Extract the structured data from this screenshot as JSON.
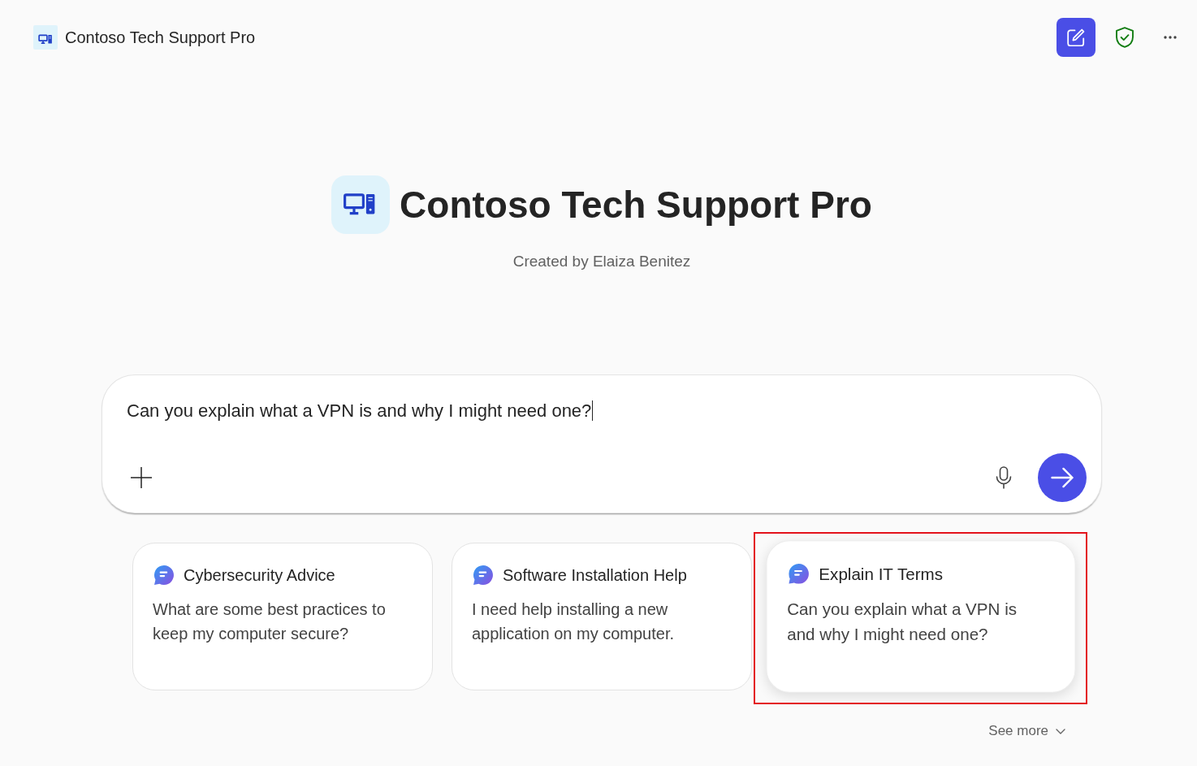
{
  "app_bar": {
    "title": "Contoso Tech Support Pro"
  },
  "hero": {
    "title": "Contoso Tech Support Pro",
    "subtitle": "Created by Elaiza Benitez"
  },
  "composer": {
    "value": "Can you explain what a VPN is and why I might need one?",
    "focused": true
  },
  "suggestions": [
    {
      "title": "Cybersecurity Advice",
      "prompt": "What are some best practices to keep my computer secure?",
      "highlighted": false
    },
    {
      "title": "Software Installation Help",
      "prompt": "I need help installing a new application on my computer.",
      "highlighted": false
    },
    {
      "title": "Explain IT Terms",
      "prompt": "Can you explain what a VPN is and why I might need one?",
      "highlighted": true
    }
  ],
  "see_more": {
    "label": "See more"
  }
}
